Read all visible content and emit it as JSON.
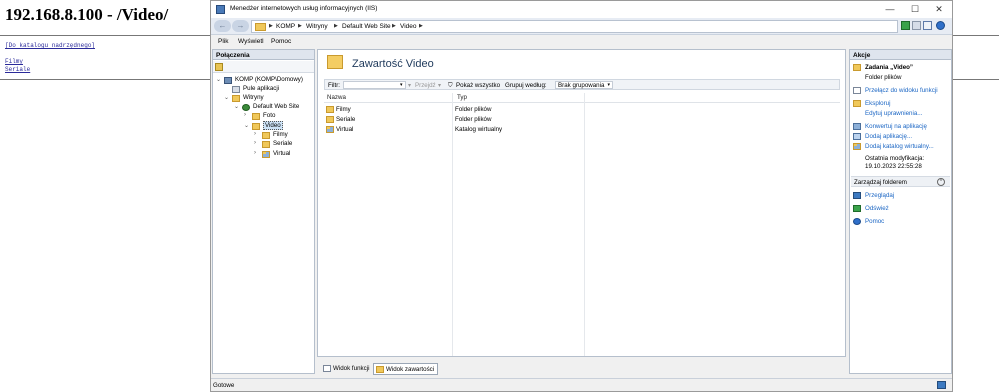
{
  "browser_page": {
    "heading": "192.168.8.100 - /Video/",
    "parent_link": "[Do katalogu nadrzędnego]",
    "links": [
      "Filmy",
      "Seriale"
    ]
  },
  "window": {
    "title": "Menedżer internetowych usług informacyjnych (IIS)",
    "controls": {
      "minimize": "—",
      "maximize": "☐",
      "close": "✕"
    }
  },
  "address": {
    "crumbs": [
      "KOMP",
      "Witryny",
      "Default Web Site",
      "Video"
    ],
    "separator": "▶"
  },
  "menu": {
    "file": "Plik",
    "view": "Wyświetl",
    "help": "Pomoc"
  },
  "connections": {
    "header": "Połączenia",
    "tree": [
      {
        "label": "KOMP (KOMP\\Domowy)",
        "icon": "server-icon",
        "toggle": "⌄"
      },
      {
        "label": "Pule aplikacji",
        "icon": "app-pool-icon",
        "toggle": ""
      },
      {
        "label": "Witryny",
        "icon": "sites-folder-icon",
        "toggle": "⌄"
      },
      {
        "label": "Default Web Site",
        "icon": "globe-icon",
        "toggle": "⌄"
      },
      {
        "label": "Foto",
        "icon": "folder-icon",
        "toggle": "›"
      },
      {
        "label": "Video",
        "icon": "folder-icon",
        "toggle": "⌄"
      },
      {
        "label": "Filmy",
        "icon": "folder-icon",
        "toggle": "›"
      },
      {
        "label": "Seriale",
        "icon": "folder-icon",
        "toggle": "›"
      },
      {
        "label": "Virtual",
        "icon": "virtual-dir-icon",
        "toggle": "›"
      }
    ]
  },
  "content": {
    "title": "Zawartość Video",
    "filter": {
      "label": "Filtr:",
      "go": "Przejdź",
      "show_all": "Pokaż wszystko",
      "group_by": "Grupuj według:",
      "group_value": "Brak grupowania"
    },
    "columns": [
      "Nazwa",
      "Typ"
    ],
    "rows": [
      {
        "name": "Filmy",
        "type": "Folder plików",
        "icon": "folder-icon"
      },
      {
        "name": "Seriale",
        "type": "Folder plików",
        "icon": "folder-icon"
      },
      {
        "name": "Virtual",
        "type": "Katalog wirtualny",
        "icon": "virtual-dir-icon"
      }
    ]
  },
  "view_tabs": {
    "features": "Widok funkcji",
    "content": "Widok zawartości"
  },
  "actions": {
    "header": "Akcje",
    "task_title": "Zadania „Video”",
    "task_subtitle": "Folder plików",
    "items": [
      "Przełącz do widoku funkcji",
      "Eksploruj",
      "Edytuj uprawnienia...",
      "Konwertuj na aplikację",
      "Dodaj aplikację...",
      "Dodaj katalog wirtualny..."
    ],
    "last_modified_label": "Ostatnia modyfikacja:",
    "last_modified_value": "19.10.2023 22:55:28",
    "manage_header": "Zarządzaj folderem",
    "manage_items": [
      "Przeglądaj",
      "Odśwież",
      "Pomoc"
    ]
  },
  "status": {
    "text": "Gotowe"
  }
}
